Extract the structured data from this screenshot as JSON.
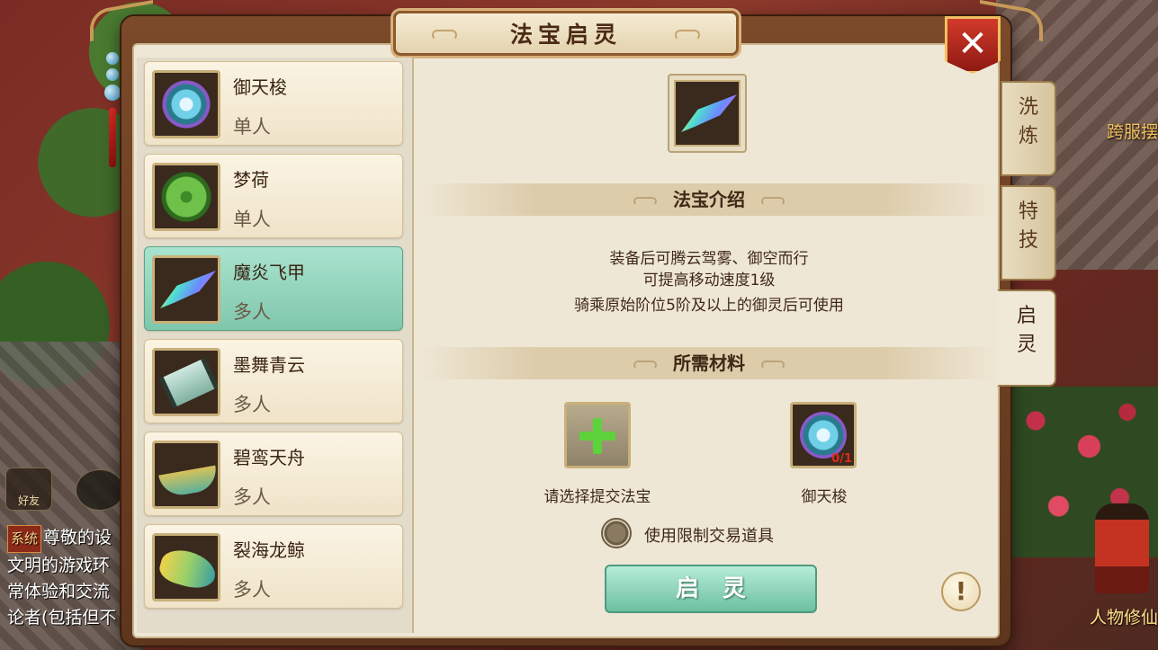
{
  "window": {
    "title": "法宝启灵"
  },
  "hud": {
    "friends_label": "好友",
    "cross_server": "跨服摆",
    "character_upgrade": "人物修仙",
    "chat": {
      "tag": "系统",
      "lines": [
        "尊敬的设",
        "文明的游戏环",
        "常体验和交流",
        "论者(包括但不"
      ]
    }
  },
  "items": [
    {
      "name": "御天梭",
      "kind": "单人",
      "icon": "star-disc-icon"
    },
    {
      "name": "梦荷",
      "kind": "单人",
      "icon": "lotus-leaf-icon"
    },
    {
      "name": "魔炎飞甲",
      "kind": "多人",
      "icon": "flame-wing-icon",
      "selected": true
    },
    {
      "name": "墨舞青云",
      "kind": "多人",
      "icon": "cloud-scroll-icon"
    },
    {
      "name": "碧鸾天舟",
      "kind": "多人",
      "icon": "phoenix-boat-icon"
    },
    {
      "name": "裂海龙鲸",
      "kind": "多人",
      "icon": "dragon-whale-icon"
    }
  ],
  "detail": {
    "intro_header": "法宝介绍",
    "intro_lines": [
      "装备后可腾云驾雾、御空而行",
      "可提高移动速度1级",
      "骑乘原始阶位5阶及以上的御灵后可使用"
    ],
    "materials_header": "所需材料",
    "materials": [
      {
        "label": "请选择提交法宝",
        "icon": "plus-icon"
      },
      {
        "label": "御天梭",
        "icon": "star-disc-icon",
        "count": "0/1"
      }
    ],
    "restricted_label": "使用限制交易道具",
    "action_label": "启灵",
    "info_label": "!"
  },
  "tabs": [
    {
      "label_1": "洗",
      "label_2": "炼"
    },
    {
      "label_1": "特",
      "label_2": "技"
    },
    {
      "label_1": "启",
      "label_2": "灵",
      "active": true
    }
  ],
  "close_label": "✕"
}
